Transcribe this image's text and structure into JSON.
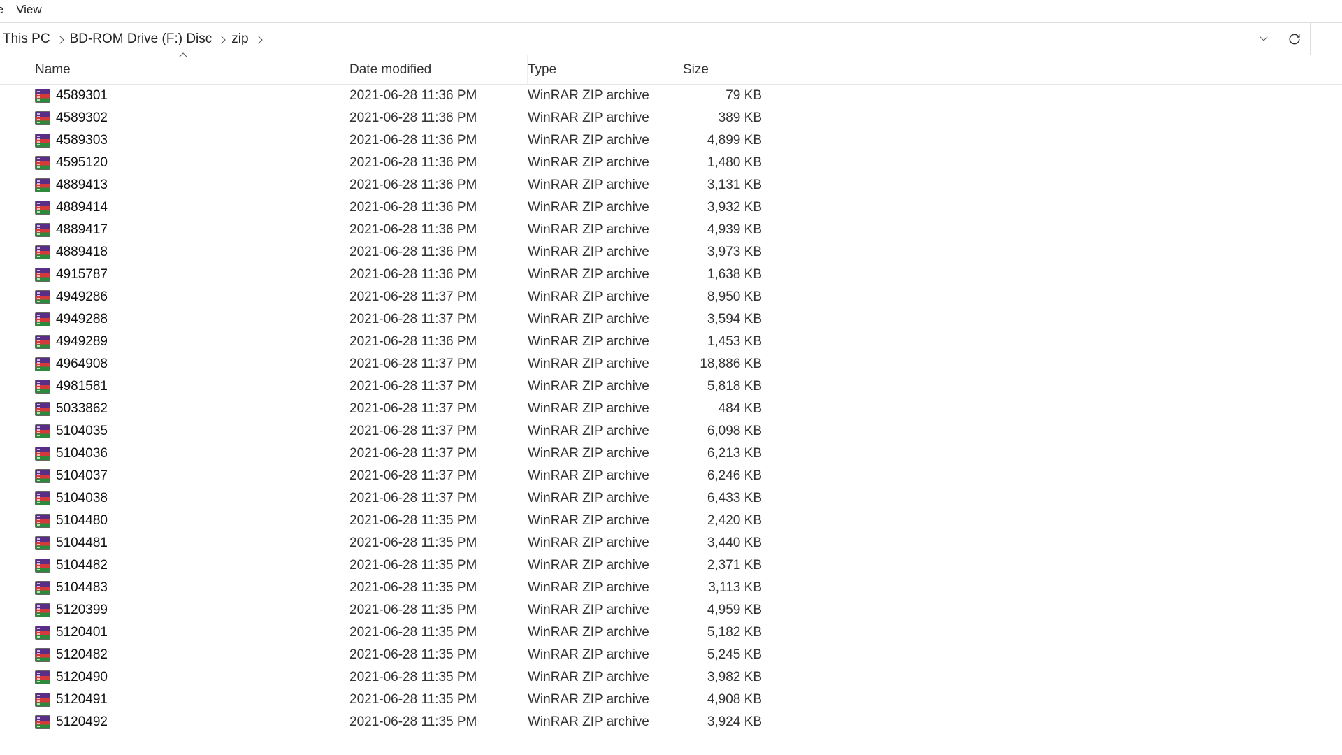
{
  "menu": {
    "items": [
      "re",
      "View"
    ]
  },
  "breadcrumb": {
    "segments": [
      "This PC",
      "BD-ROM Drive (F:) Disc",
      "zip"
    ]
  },
  "columns": {
    "name": "Name",
    "date": "Date modified",
    "type": "Type",
    "size": "Size"
  },
  "files": [
    {
      "name": "4589301",
      "date": "2021-06-28 11:36 PM",
      "type": "WinRAR ZIP archive",
      "size": "79 KB"
    },
    {
      "name": "4589302",
      "date": "2021-06-28 11:36 PM",
      "type": "WinRAR ZIP archive",
      "size": "389 KB"
    },
    {
      "name": "4589303",
      "date": "2021-06-28 11:36 PM",
      "type": "WinRAR ZIP archive",
      "size": "4,899 KB"
    },
    {
      "name": "4595120",
      "date": "2021-06-28 11:36 PM",
      "type": "WinRAR ZIP archive",
      "size": "1,480 KB"
    },
    {
      "name": "4889413",
      "date": "2021-06-28 11:36 PM",
      "type": "WinRAR ZIP archive",
      "size": "3,131 KB"
    },
    {
      "name": "4889414",
      "date": "2021-06-28 11:36 PM",
      "type": "WinRAR ZIP archive",
      "size": "3,932 KB"
    },
    {
      "name": "4889417",
      "date": "2021-06-28 11:36 PM",
      "type": "WinRAR ZIP archive",
      "size": "4,939 KB"
    },
    {
      "name": "4889418",
      "date": "2021-06-28 11:36 PM",
      "type": "WinRAR ZIP archive",
      "size": "3,973 KB"
    },
    {
      "name": "4915787",
      "date": "2021-06-28 11:36 PM",
      "type": "WinRAR ZIP archive",
      "size": "1,638 KB"
    },
    {
      "name": "4949286",
      "date": "2021-06-28 11:37 PM",
      "type": "WinRAR ZIP archive",
      "size": "8,950 KB"
    },
    {
      "name": "4949288",
      "date": "2021-06-28 11:37 PM",
      "type": "WinRAR ZIP archive",
      "size": "3,594 KB"
    },
    {
      "name": "4949289",
      "date": "2021-06-28 11:36 PM",
      "type": "WinRAR ZIP archive",
      "size": "1,453 KB"
    },
    {
      "name": "4964908",
      "date": "2021-06-28 11:37 PM",
      "type": "WinRAR ZIP archive",
      "size": "18,886 KB"
    },
    {
      "name": "4981581",
      "date": "2021-06-28 11:37 PM",
      "type": "WinRAR ZIP archive",
      "size": "5,818 KB"
    },
    {
      "name": "5033862",
      "date": "2021-06-28 11:37 PM",
      "type": "WinRAR ZIP archive",
      "size": "484 KB"
    },
    {
      "name": "5104035",
      "date": "2021-06-28 11:37 PM",
      "type": "WinRAR ZIP archive",
      "size": "6,098 KB"
    },
    {
      "name": "5104036",
      "date": "2021-06-28 11:37 PM",
      "type": "WinRAR ZIP archive",
      "size": "6,213 KB"
    },
    {
      "name": "5104037",
      "date": "2021-06-28 11:37 PM",
      "type": "WinRAR ZIP archive",
      "size": "6,246 KB"
    },
    {
      "name": "5104038",
      "date": "2021-06-28 11:37 PM",
      "type": "WinRAR ZIP archive",
      "size": "6,433 KB"
    },
    {
      "name": "5104480",
      "date": "2021-06-28 11:35 PM",
      "type": "WinRAR ZIP archive",
      "size": "2,420 KB"
    },
    {
      "name": "5104481",
      "date": "2021-06-28 11:35 PM",
      "type": "WinRAR ZIP archive",
      "size": "3,440 KB"
    },
    {
      "name": "5104482",
      "date": "2021-06-28 11:35 PM",
      "type": "WinRAR ZIP archive",
      "size": "2,371 KB"
    },
    {
      "name": "5104483",
      "date": "2021-06-28 11:35 PM",
      "type": "WinRAR ZIP archive",
      "size": "3,113 KB"
    },
    {
      "name": "5120399",
      "date": "2021-06-28 11:35 PM",
      "type": "WinRAR ZIP archive",
      "size": "4,959 KB"
    },
    {
      "name": "5120401",
      "date": "2021-06-28 11:35 PM",
      "type": "WinRAR ZIP archive",
      "size": "5,182 KB"
    },
    {
      "name": "5120482",
      "date": "2021-06-28 11:35 PM",
      "type": "WinRAR ZIP archive",
      "size": "5,245 KB"
    },
    {
      "name": "5120490",
      "date": "2021-06-28 11:35 PM",
      "type": "WinRAR ZIP archive",
      "size": "3,982 KB"
    },
    {
      "name": "5120491",
      "date": "2021-06-28 11:35 PM",
      "type": "WinRAR ZIP archive",
      "size": "4,908 KB"
    },
    {
      "name": "5120492",
      "date": "2021-06-28 11:35 PM",
      "type": "WinRAR ZIP archive",
      "size": "3,924 KB"
    }
  ]
}
